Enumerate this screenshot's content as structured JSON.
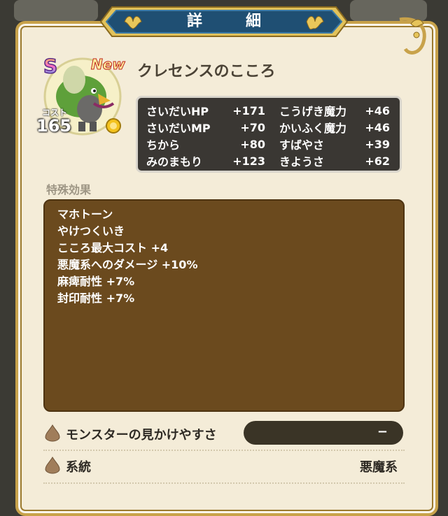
{
  "header": {
    "title": "詳　細"
  },
  "monster": {
    "rank": "S",
    "new_badge": "New",
    "name": "クレセンスのこころ",
    "cost_label": "コスト",
    "cost_value": "165"
  },
  "stats": [
    {
      "name": "さいだいHP",
      "value": "+171",
      "name2": "こうげき魔力",
      "value2": "+46"
    },
    {
      "name": "さいだいMP",
      "value": "+70",
      "name2": "かいふく魔力",
      "value2": "+46"
    },
    {
      "name": "ちから",
      "value": "+80",
      "name2": "すばやさ",
      "value2": "+39"
    },
    {
      "name": "みのまもり",
      "value": "+123",
      "name2": "きようさ",
      "value2": "+62"
    }
  ],
  "special_effects": {
    "label": "特殊効果",
    "items": [
      "マホトーン",
      "やけつくいき",
      "こころ最大コスト +4",
      "悪魔系へのダメージ +10%",
      "麻痺耐性 +7%",
      "封印耐性 +7%"
    ]
  },
  "visibility": {
    "label": "モンスターの見かけやすさ",
    "value": "−"
  },
  "family": {
    "label": "系統",
    "value": "悪魔系"
  },
  "colors": {
    "panel": "#f4ecd8",
    "banner": "#1f4f73",
    "gold": "#c8a24a",
    "effects_bg": "#6b4a1e"
  },
  "icons": {
    "row_icon": "chestnut-drop-icon",
    "banner_icon": "fleur-de-lis-icon",
    "coin": "gold-coin-icon"
  }
}
